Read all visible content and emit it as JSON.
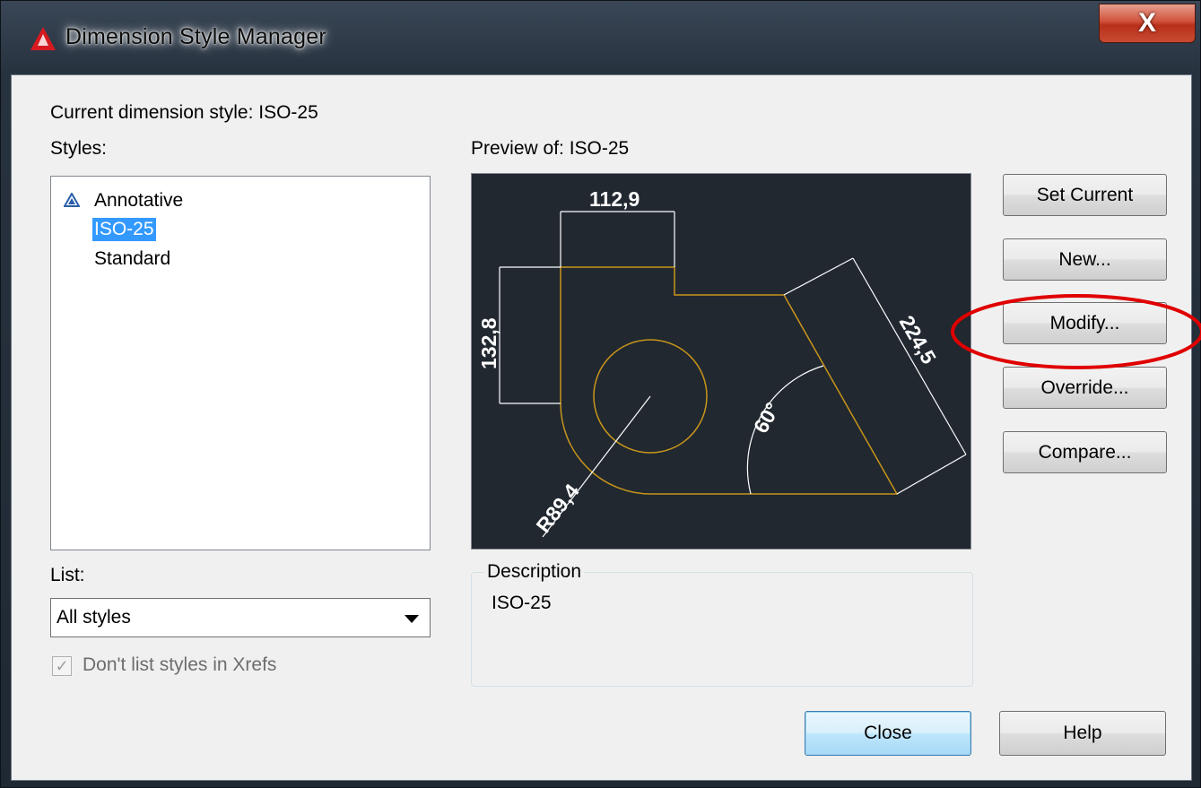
{
  "window": {
    "title": "Dimension Style Manager",
    "close_glyph": "X"
  },
  "current_style_label": "Current dimension style: ISO-25",
  "styles_label": "Styles:",
  "styles": [
    {
      "name": "Annotative",
      "annotative": true,
      "selected": false
    },
    {
      "name": "ISO-25",
      "annotative": false,
      "selected": true
    },
    {
      "name": "Standard",
      "annotative": false,
      "selected": false
    }
  ],
  "list_label": "List:",
  "list_select": {
    "value": "All styles"
  },
  "xref_checkbox": {
    "label": "Don't list styles in Xrefs",
    "checked": true,
    "enabled": false
  },
  "preview_label": "Preview of: ISO-25",
  "preview_dims": {
    "horizontal": "112,9",
    "vertical": "132,8",
    "aligned": "224,5",
    "angle": "60°",
    "radius": "R89,4"
  },
  "description": {
    "title": "Description",
    "text": "ISO-25"
  },
  "buttons": {
    "set_current": "Set Current",
    "new": "New...",
    "modify": "Modify...",
    "override": "Override...",
    "compare": "Compare...",
    "close": "Close",
    "help": "Help"
  },
  "colors": {
    "preview_bg": "#212830",
    "geometry": "#c8951a",
    "dimension": "#ffffff",
    "selection": "#3399ff",
    "annotation_ellipse": "#e00000"
  }
}
